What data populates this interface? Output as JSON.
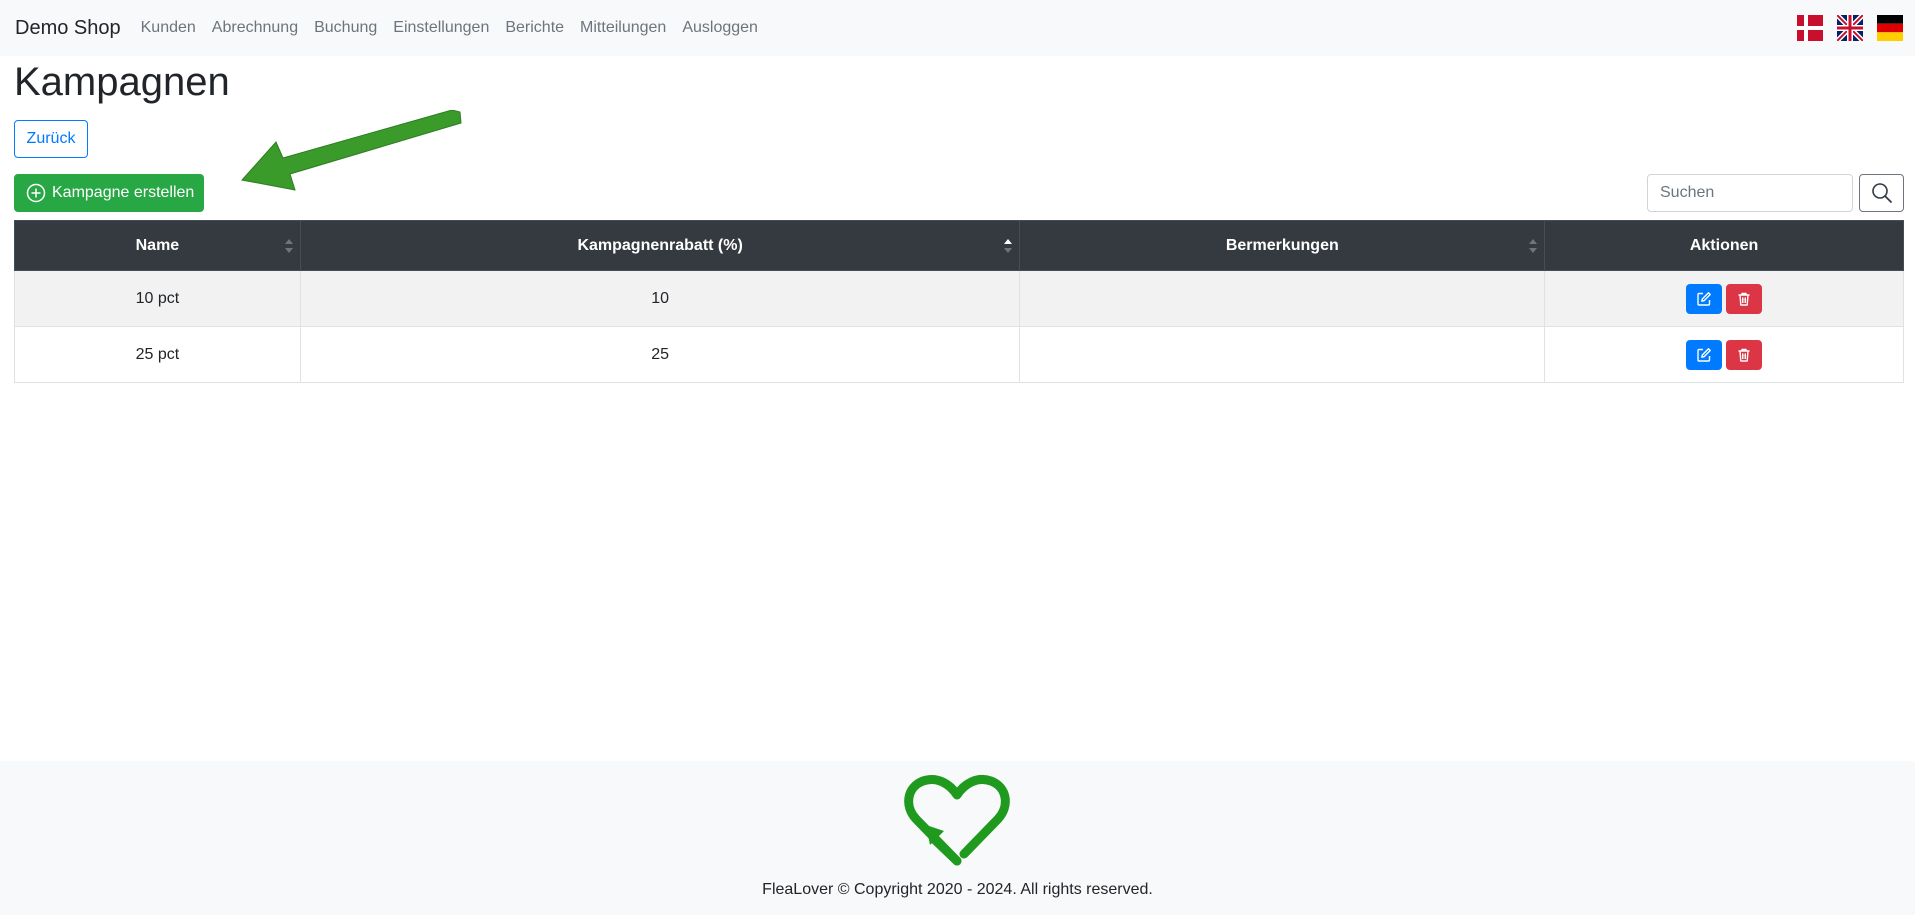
{
  "navbar": {
    "brand": "Demo Shop",
    "links": [
      "Kunden",
      "Abrechnung",
      "Buchung",
      "Einstellungen",
      "Berichte",
      "Mitteilungen",
      "Ausloggen"
    ],
    "flags": [
      "flag-denmark-icon",
      "flag-uk-icon",
      "flag-germany-icon"
    ]
  },
  "page": {
    "title": "Kampagnen",
    "back_label": "Zurück",
    "create_label": "Kampagne erstellen"
  },
  "search": {
    "placeholder": "Suchen",
    "value": ""
  },
  "table": {
    "columns": [
      "Name",
      "Kampagnenrabatt (%)",
      "Bermerkungen",
      "Aktionen"
    ],
    "rows": [
      {
        "name": "10 pct",
        "discount": "10",
        "remarks": ""
      },
      {
        "name": "25 pct",
        "discount": "25",
        "remarks": ""
      }
    ]
  },
  "footer": {
    "text": "FleaLover © Copyright 2020 - 2024. All rights reserved."
  },
  "colors": {
    "primary": "#007bff",
    "success": "#28a745",
    "danger": "#dc3545",
    "table_header": "#343a40",
    "annotation_arrow": "#3a9a2a"
  }
}
